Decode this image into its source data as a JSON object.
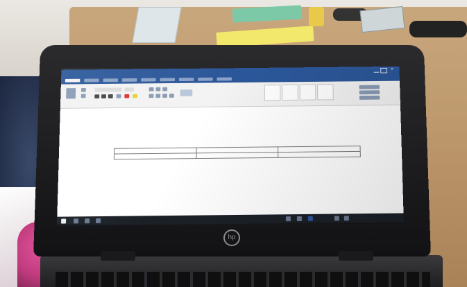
{
  "photo": {
    "subject": "laptop-on-desk",
    "laptop_brand_icon": "hp-logo-icon"
  },
  "window": {
    "app": "Word",
    "title": "",
    "accent_color": "#2b579a"
  },
  "document": {
    "table": {
      "rows": [
        [
          "",
          "",
          ""
        ],
        [
          "",
          "",
          ""
        ]
      ]
    },
    "paragraphs": [
      "",
      "",
      "",
      ""
    ]
  },
  "taskbar": {
    "clock": ""
  }
}
